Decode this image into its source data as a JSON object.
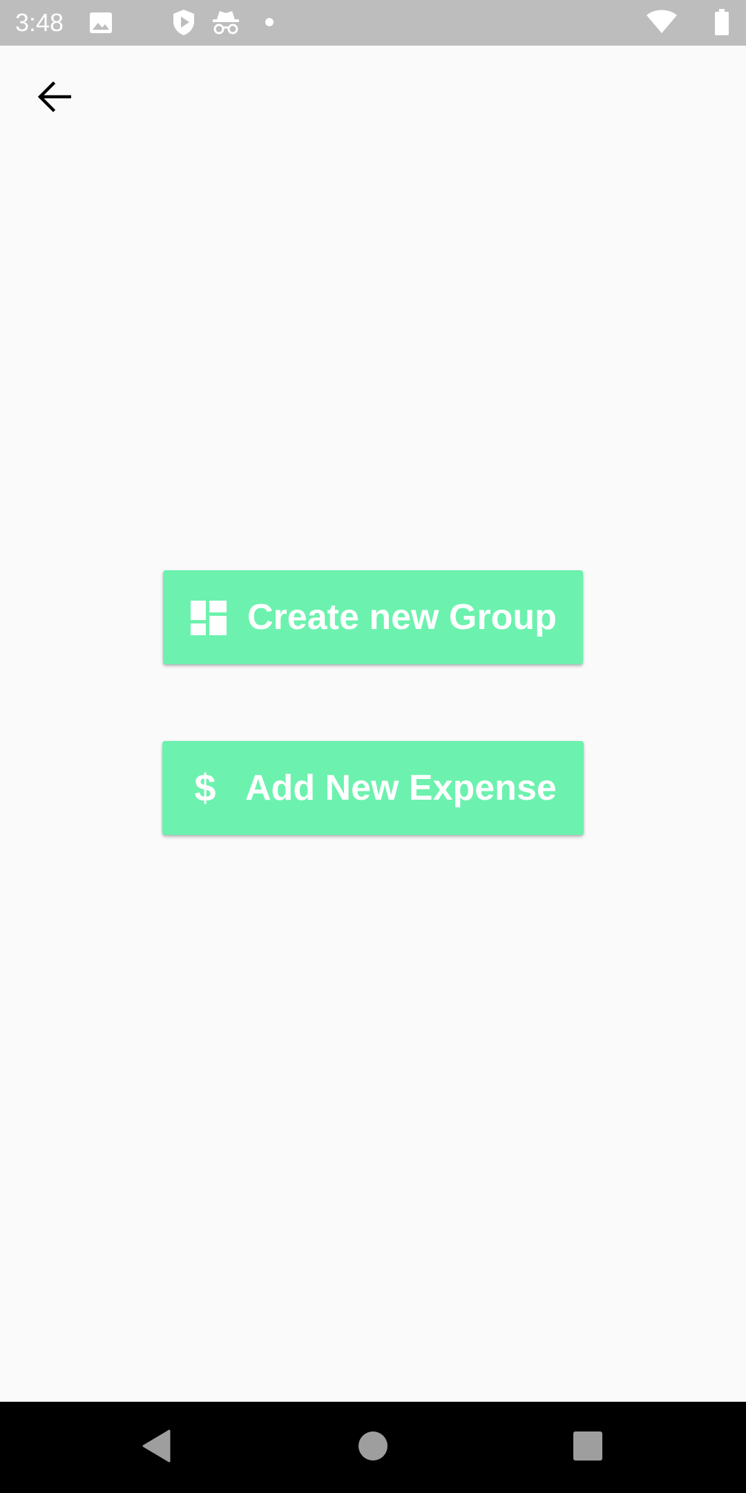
{
  "status_bar": {
    "time": "3:48",
    "icons": [
      "image-icon",
      "play-protect-icon",
      "incognito-icon",
      "dot-icon",
      "wifi-icon",
      "battery-icon"
    ]
  },
  "app_bar": {
    "back_icon": "arrow-back-icon"
  },
  "actions": {
    "create_group": {
      "label": "Create new Group",
      "icon": "dashboard-icon"
    },
    "add_expense": {
      "label": "Add New Expense",
      "icon": "dollar-icon",
      "symbol": "$"
    }
  },
  "nav_bar": {
    "icons": [
      "back-triangle-icon",
      "home-circle-icon",
      "recents-square-icon"
    ]
  },
  "colors": {
    "accent": "#6cf2ae",
    "background": "#fafafa",
    "status_bar": "#bdbdbd",
    "nav_bar": "#000000"
  }
}
